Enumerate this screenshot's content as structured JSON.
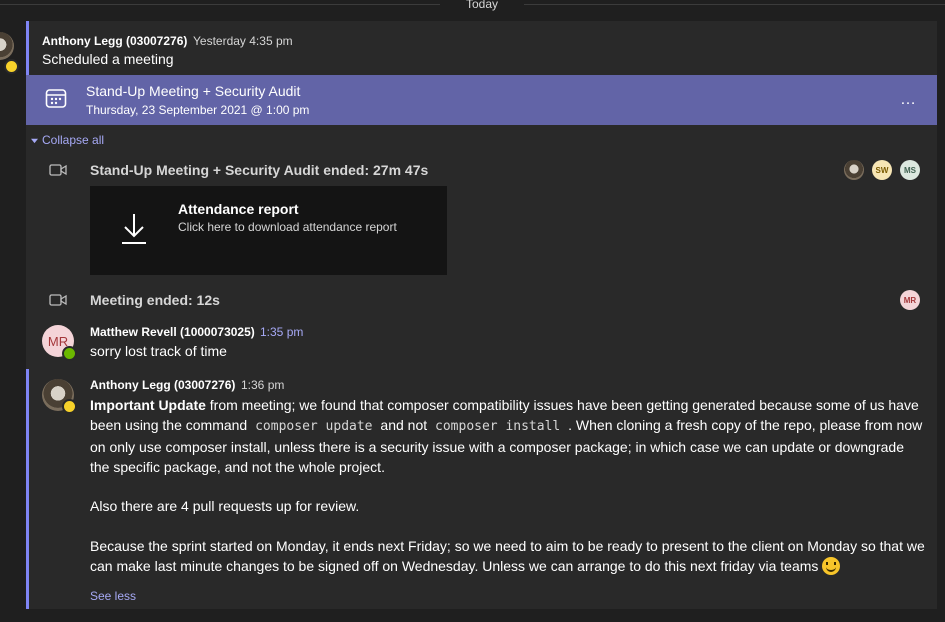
{
  "divider": {
    "label": "Today"
  },
  "thread": {
    "author": "Anthony Legg (03007276)",
    "time": "Yesterday 4:35 pm",
    "text": "Scheduled a meeting",
    "meeting": {
      "title": "Stand-Up Meeting + Security Audit",
      "date": "Thursday, 23 September 2021 @ 1:00 pm",
      "more_label": "…"
    },
    "collapse_label": "Collapse all"
  },
  "events": [
    {
      "title": "Stand-Up Meeting + Security Audit ended: 27m 47s",
      "participants": [
        "SW",
        "MS"
      ]
    },
    {
      "title": "Meeting ended: 12s",
      "participants": [
        "MR"
      ]
    }
  ],
  "attendance": {
    "title": "Attendance report",
    "subtitle": "Click here to download attendance report"
  },
  "replies": [
    {
      "author": "Matthew Revell (1000073025)",
      "initials": "MR",
      "time": "1:35 pm",
      "text": "sorry lost track of time"
    },
    {
      "author": "Anthony Legg (03007276)",
      "time": "1:36 pm",
      "bold_lead": "Important Update",
      "p1_a": " from meeting; we found that composer compatibility issues have been getting generated because some of us have been using the command",
      "code1": "composer update",
      "p1_b": "and not",
      "code2": "composer install",
      "p1_c": ". When cloning a fresh copy of the repo, please from now on only use composer install, unless there is a security issue with a composer package; in which case we can update or downgrade the specific package, and not the whole project.",
      "p2": "Also there are 4 pull requests up for review.",
      "p3": "Because the sprint started on Monday, it ends next Friday; so we need to aim to be ready to present to the client on Monday so that we can make last minute changes to be signed off on Wednesday. Unless we can arrange to do this next friday via teams",
      "see_less": "See less"
    }
  ],
  "colors": {
    "accent": "#6264a7",
    "link": "#a6a9f5",
    "away": "#f8d22a",
    "available": "#6bb700"
  }
}
